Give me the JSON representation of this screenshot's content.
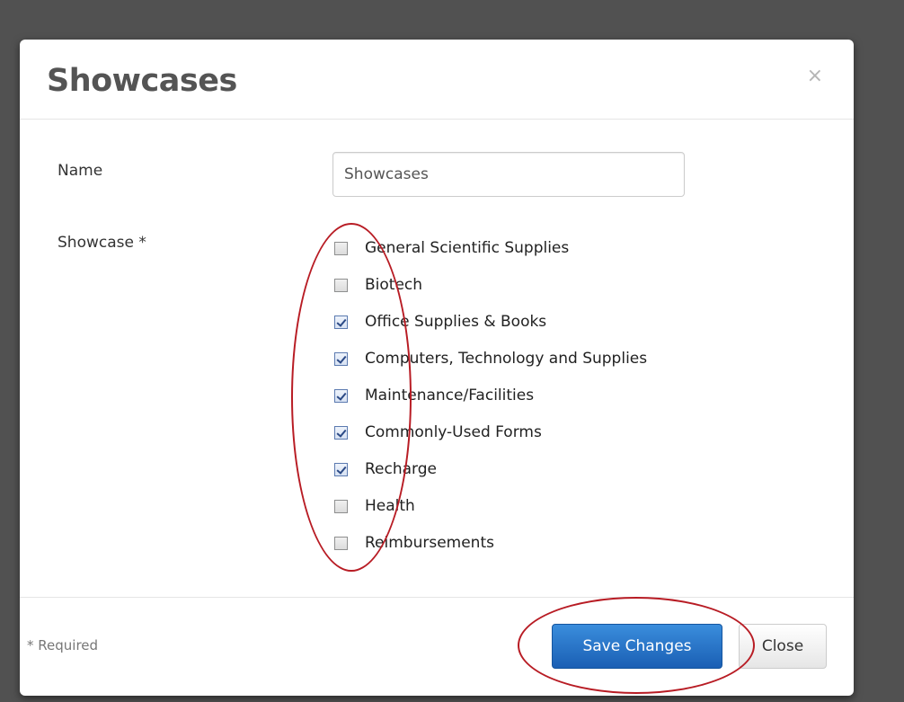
{
  "modal": {
    "title": "Showcases",
    "close_glyph": "×"
  },
  "form": {
    "name_label": "Name",
    "name_value": "Showcases",
    "showcase_label": "Showcase *",
    "showcases": [
      {
        "label": "General Scientific Supplies",
        "checked": false
      },
      {
        "label": "Biotech",
        "checked": false
      },
      {
        "label": "Office Supplies & Books",
        "checked": true
      },
      {
        "label": "Computers, Technology and Supplies",
        "checked": true
      },
      {
        "label": "Maintenance/Facilities",
        "checked": true
      },
      {
        "label": "Commonly-Used Forms",
        "checked": true
      },
      {
        "label": "Recharge",
        "checked": true
      },
      {
        "label": "Health",
        "checked": false
      },
      {
        "label": "Reimbursements",
        "checked": false
      }
    ]
  },
  "footer": {
    "required_note": "* Required",
    "save_label": "Save Changes",
    "close_label": "Close"
  },
  "colors": {
    "backdrop": "#515151",
    "primary_button": "#1a5fb4",
    "annotation": "#b81c24"
  },
  "icons": {
    "close": "close-icon",
    "checkbox": "checkbox-icon"
  }
}
